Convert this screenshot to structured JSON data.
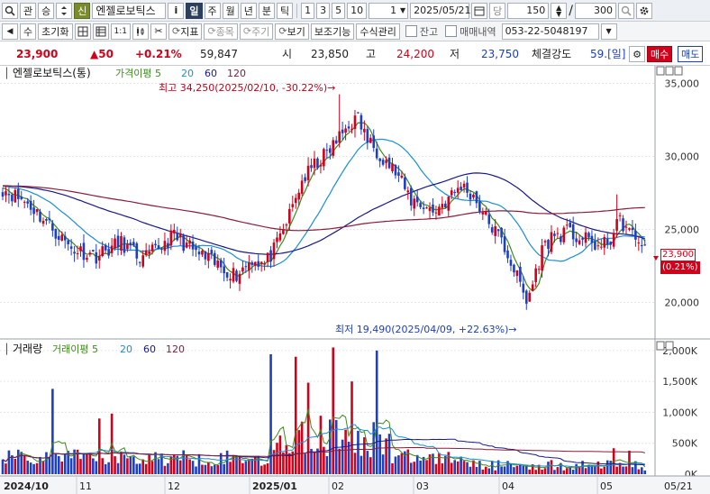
{
  "toolbar1": {
    "search_icon": "search-icon",
    "btn_gwan": "관",
    "btn_seung": "승",
    "btn_sin": "신",
    "stock_name": "엔젤로보틱스",
    "btn_info": "i",
    "periods": [
      "일",
      "주",
      "월",
      "년",
      "분",
      "틱"
    ],
    "active_period": "일",
    "minute_options": [
      "1",
      "3",
      "5",
      "10"
    ],
    "count_value": "1",
    "date_value": "2025/05/21",
    "btn_dang": "당",
    "display_count": "150",
    "slash": "/",
    "total_count": "300"
  },
  "toolbar2": {
    "btn_su": "수",
    "btn_init": "초기화",
    "btn_11": "1:1",
    "btn_indicator": "지표",
    "btn_item": "종목",
    "btn_period": "주기",
    "btn_view": "보기",
    "btn_aux": "보조기능",
    "btn_formula": "수식관리",
    "chk_balance": "잔고",
    "chk_trade": "매매내역",
    "phone": "053-22-5048197"
  },
  "quote": {
    "price": "23,900",
    "change": "▲50",
    "change_pct": "+0.21%",
    "volume": "59,847",
    "open_label": "시",
    "open": "23,850",
    "high_label": "고",
    "high": "24,200",
    "low_label": "저",
    "low": "23,750",
    "strength_label": "체결강도",
    "strength": "59.[일]",
    "buy_btn": "매수",
    "sell_btn": "매도"
  },
  "price_pane": {
    "title": "엔젤로보틱스(통)",
    "legend": [
      {
        "label": "가격이평 5",
        "color": "#3d8b1d"
      },
      {
        "label": "20",
        "color": "#1a8fd6"
      },
      {
        "label": "60",
        "color": "#1a1a8c"
      },
      {
        "label": "120",
        "color": "#8b1c3a"
      }
    ],
    "high_annotation": "최고 34,250(2025/02/10, -30.22%)→",
    "low_annotation": "최저 19,490(2025/04/09, +22.63%)→",
    "current_tag": "23,900",
    "current_pct_tag": "(0.21%)"
  },
  "volume_pane": {
    "title": "거래량",
    "legend": [
      {
        "label": "거래이평 5",
        "color": "#3d8b1d"
      },
      {
        "label": "20",
        "color": "#1a8fd6"
      },
      {
        "label": "60",
        "color": "#1a1a8c"
      },
      {
        "label": "120",
        "color": "#8b1c3a"
      }
    ]
  },
  "chart_data": [
    {
      "type": "candlestick",
      "y_ticks": [
        "35,000",
        "30,000",
        "25,000",
        "20,000"
      ],
      "ylim": [
        17500,
        36200
      ],
      "x_ticks": [
        "2024/10",
        "11",
        "12",
        "2025/01",
        "02",
        "03",
        "04",
        "05",
        "05/21"
      ],
      "series": [
        {
          "name": "가격이평 5",
          "color": "#3d8b1d"
        },
        {
          "name": "20",
          "color": "#1a8fd6"
        },
        {
          "name": "60",
          "color": "#1a1a8c"
        },
        {
          "name": "120",
          "color": "#8b1c3a"
        }
      ],
      "anchors": [
        [
          0,
          27800
        ],
        [
          8,
          26800
        ],
        [
          14,
          25500
        ],
        [
          22,
          23700
        ],
        [
          30,
          23200
        ],
        [
          38,
          24100
        ],
        [
          45,
          22900
        ],
        [
          55,
          24600
        ],
        [
          62,
          23400
        ],
        [
          70,
          22400
        ],
        [
          75,
          21900
        ],
        [
          80,
          23000
        ],
        [
          84,
          22600
        ],
        [
          88,
          23900
        ],
        [
          92,
          26000
        ],
        [
          96,
          28300
        ],
        [
          100,
          29400
        ],
        [
          104,
          30200
        ],
        [
          108,
          31300
        ],
        [
          111,
          32200
        ],
        [
          114,
          32600
        ],
        [
          117,
          31100
        ],
        [
          121,
          30200
        ],
        [
          126,
          28900
        ],
        [
          131,
          27000
        ],
        [
          134,
          26800
        ],
        [
          138,
          26200
        ],
        [
          143,
          27100
        ],
        [
          147,
          28000
        ],
        [
          151,
          27300
        ],
        [
          155,
          25800
        ],
        [
          160,
          24200
        ],
        [
          163,
          22800
        ],
        [
          166,
          21200
        ],
        [
          168,
          20000
        ],
        [
          170,
          21300
        ],
        [
          173,
          23600
        ],
        [
          176,
          24500
        ],
        [
          181,
          24800
        ],
        [
          185,
          24400
        ],
        [
          189,
          24100
        ],
        [
          192,
          23700
        ],
        [
          195,
          24400
        ],
        [
          198,
          25600
        ],
        [
          200,
          25100
        ],
        [
          203,
          24300
        ],
        [
          205,
          24200
        ],
        [
          206,
          23900
        ]
      ],
      "spikes": [
        [
          108,
          34250
        ],
        [
          168,
          19490
        ],
        [
          197,
          27400
        ]
      ],
      "high_point": {
        "x": "2025/02/10",
        "y": 34250
      },
      "low_point": {
        "x": "2025/04/09",
        "y": 19490
      },
      "last": 23900
    },
    {
      "type": "bar",
      "y_ticks": [
        "2,000K",
        "1,500K",
        "1,000K",
        "500K",
        "0K"
      ],
      "ylim": [
        0,
        2100000
      ],
      "series": [
        {
          "name": "거래이평 5",
          "color": "#3d8b1d"
        },
        {
          "name": "20",
          "color": "#1a8fd6"
        },
        {
          "name": "60",
          "color": "#1a1a8c"
        },
        {
          "name": "120",
          "color": "#8b1c3a"
        }
      ],
      "big_volume": [
        [
          16,
          1380000
        ],
        [
          31,
          900000
        ],
        [
          35,
          980000
        ],
        [
          86,
          1940000
        ],
        [
          94,
          1900000
        ],
        [
          98,
          1480000
        ],
        [
          106,
          2050000
        ],
        [
          112,
          1500000
        ],
        [
          120,
          2000000
        ],
        [
          96,
          850000
        ],
        [
          110,
          720000
        ],
        [
          196,
          420000
        ],
        [
          201,
          380000
        ]
      ],
      "last": 59847
    }
  ]
}
